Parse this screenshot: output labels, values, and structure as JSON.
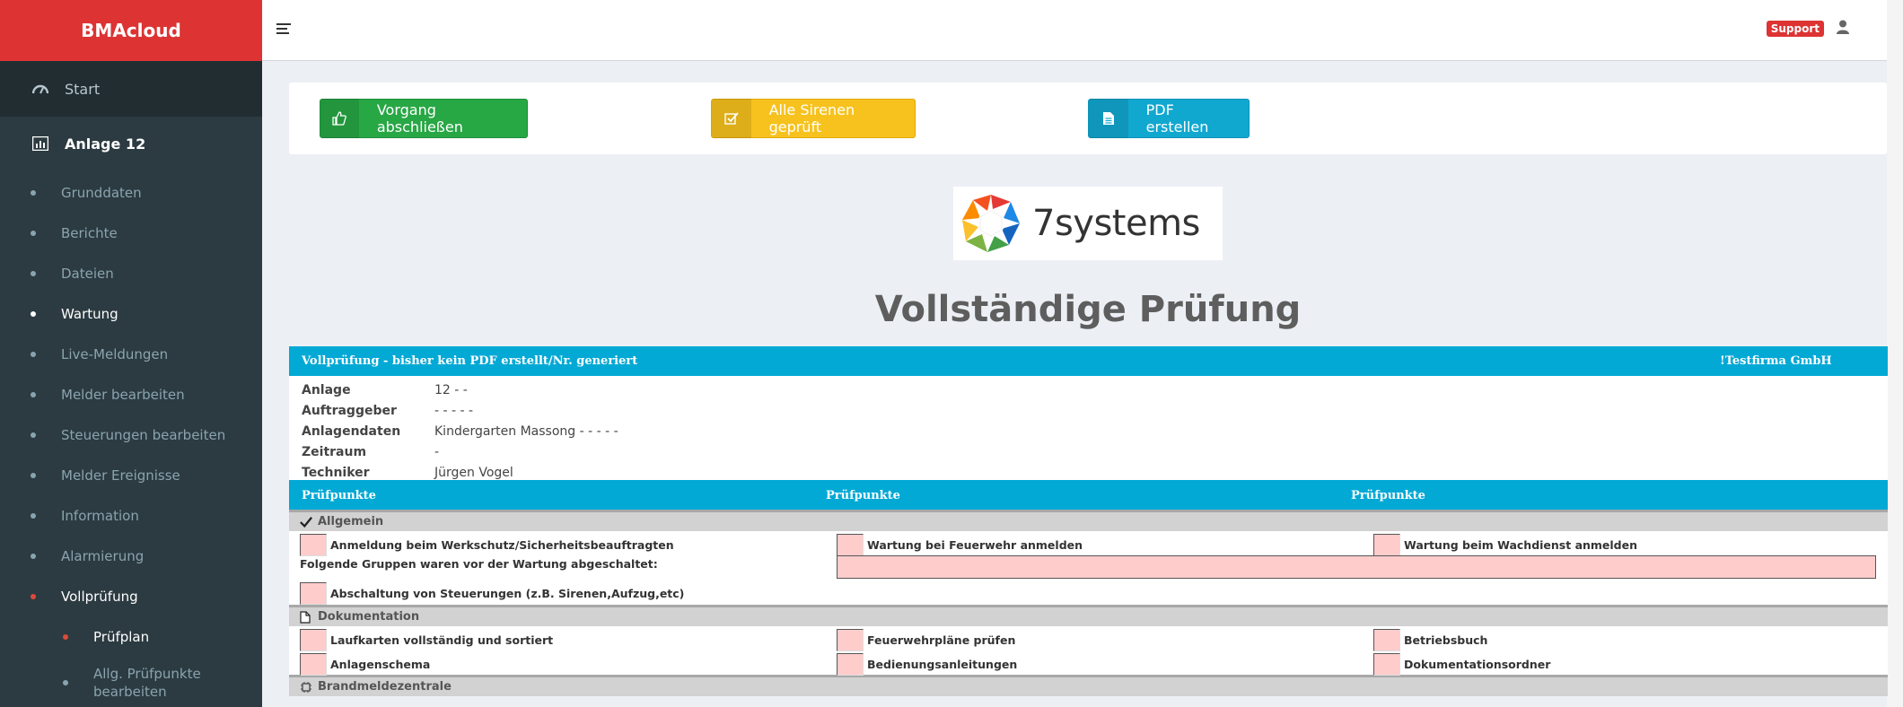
{
  "app": {
    "brand": "BMAcloud",
    "support_label": "Support"
  },
  "sidebar": {
    "start_label": "Start",
    "anlage_label": "Anlage 12",
    "items": [
      {
        "label": "Grunddaten"
      },
      {
        "label": "Berichte"
      },
      {
        "label": "Dateien"
      },
      {
        "label": "Wartung"
      },
      {
        "label": "Live-Meldungen"
      },
      {
        "label": "Melder bearbeiten"
      },
      {
        "label": "Steuerungen bearbeiten"
      },
      {
        "label": "Melder Ereignisse"
      },
      {
        "label": "Information"
      },
      {
        "label": "Alarmierung"
      },
      {
        "label": "Vollprüfung"
      }
    ],
    "subitems": [
      {
        "label": "Prüfplan"
      },
      {
        "label": "Allg. Prüfpunkte bearbeiten"
      }
    ]
  },
  "actions": {
    "finish": "Vorgang abschließen",
    "sirens": "Alle Sirenen geprüft",
    "pdf": "PDF erstellen"
  },
  "logo": {
    "text": "7systems"
  },
  "page_title": "Vollständige Prüfung",
  "report": {
    "header_left": "Vollprüfung - bisher kein PDF erstellt/Nr. generiert",
    "header_right": "!Testfirma GmbH",
    "info": [
      {
        "key": "Anlage",
        "value": "12 - -"
      },
      {
        "key": "Auftraggeber",
        "value": "- - - - -"
      },
      {
        "key": "Anlagendaten",
        "value": "Kindergarten Massong - - - - -"
      },
      {
        "key": "Zeitraum",
        "value": "-"
      },
      {
        "key": "Techniker",
        "value": "Jürgen Vogel"
      }
    ],
    "col_header": "Prüfpunkte",
    "sections": {
      "allgemein": {
        "title": "Allgemein",
        "row1": [
          "Anmeldung beim Werkschutz/Sicherheitsbeauftragten",
          "Wartung bei Feuerwehr anmelden",
          "Wartung beim Wachdienst anmelden"
        ],
        "groups_label": "Folgende Gruppen waren vor der Wartung abgeschaltet:",
        "row3": "Abschaltung von Steuerungen (z.B. Sirenen,Aufzug,etc)"
      },
      "dokumentation": {
        "title": "Dokumentation",
        "row1": [
          "Laufkarten vollständig und sortiert",
          "Feuerwehrpläne prüfen",
          "Betriebsbuch"
        ],
        "row2": [
          "Anlagenschema",
          "Bedienungsanleitungen",
          "Dokumentationsordner"
        ]
      },
      "bmz": {
        "title": "Brandmeldezentrale"
      }
    }
  }
}
